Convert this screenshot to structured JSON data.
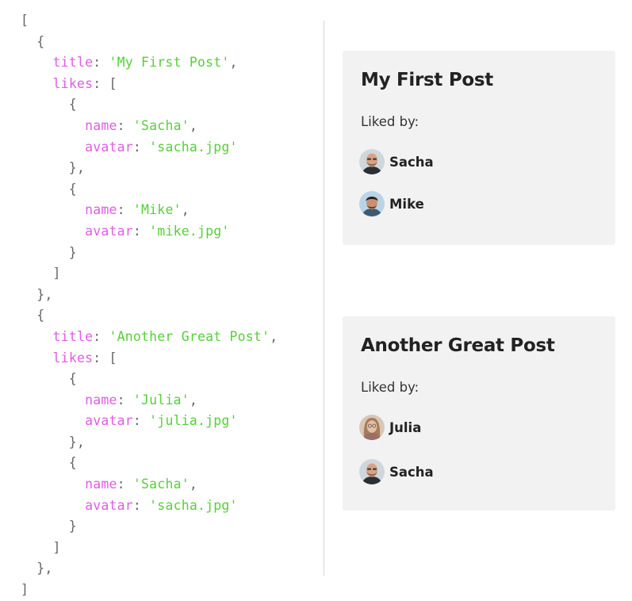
{
  "code": {
    "open_bracket": "[",
    "close_bracket": "]",
    "posts": [
      {
        "title_key": "title",
        "title_value": "'My First Post'",
        "likes_key": "likes",
        "likes": [
          {
            "name_key": "name",
            "name_value": "'Sacha'",
            "avatar_key": "avatar",
            "avatar_value": "'sacha.jpg'"
          },
          {
            "name_key": "name",
            "name_value": "'Mike'",
            "avatar_key": "avatar",
            "avatar_value": "'mike.jpg'"
          }
        ]
      },
      {
        "title_key": "title",
        "title_value": "'Another Great Post'",
        "likes_key": "likes",
        "likes": [
          {
            "name_key": "name",
            "name_value": "'Julia'",
            "avatar_key": "avatar",
            "avatar_value": "'julia.jpg'"
          },
          {
            "name_key": "name",
            "name_value": "'Sacha'",
            "avatar_key": "avatar",
            "avatar_value": "'sacha.jpg'"
          }
        ]
      }
    ]
  },
  "cards": [
    {
      "title": "My First Post",
      "liked_by_label": "Liked by:",
      "users": [
        {
          "name": "Sacha",
          "avatar_icon": "avatar-sacha-icon"
        },
        {
          "name": "Mike",
          "avatar_icon": "avatar-mike-icon"
        }
      ]
    },
    {
      "title": "Another Great Post",
      "liked_by_label": "Liked by:",
      "users": [
        {
          "name": "Julia",
          "avatar_icon": "avatar-julia-icon"
        },
        {
          "name": "Sacha",
          "avatar_icon": "avatar-sacha-icon"
        }
      ]
    }
  ],
  "colors": {
    "key": "#e05ce5",
    "string": "#55d137",
    "card_bg": "#f2f2f2",
    "divider": "#d6d6d6"
  }
}
